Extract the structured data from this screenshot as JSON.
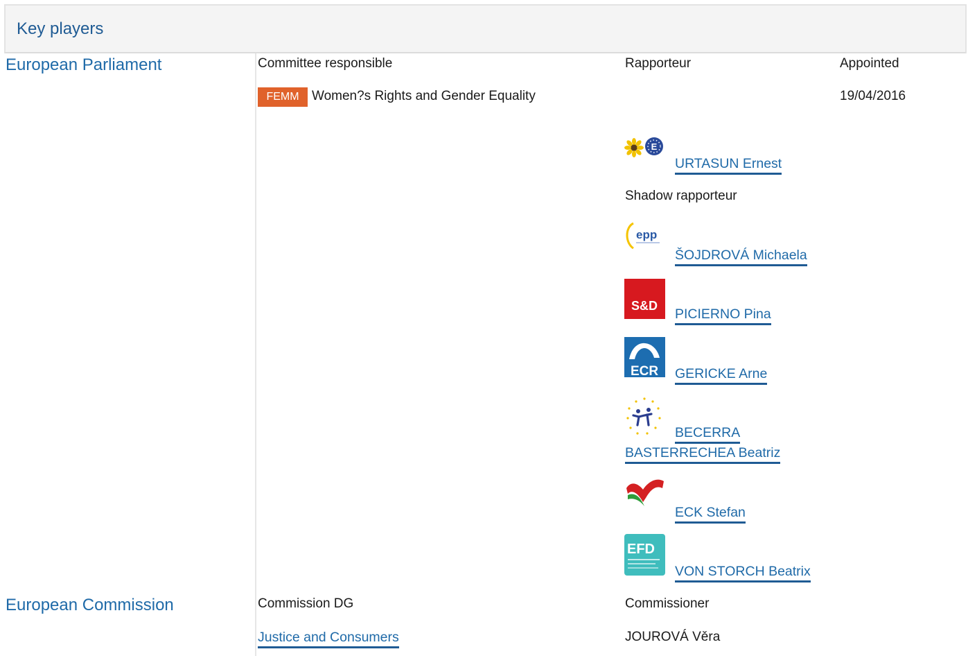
{
  "header": {
    "title": "Key players"
  },
  "parliament": {
    "label": "European Parliament",
    "committee_header": "Committee responsible",
    "rapporteur_header": "Rapporteur",
    "appointed_header": "Appointed",
    "committee_badge": "FEMM",
    "committee_name": "Women?s Rights and Gender Equality",
    "appointed_date": "19/04/2016",
    "rapporteur": {
      "name": "URTASUN Ernest",
      "group_icon": "greens-efa-logo-icon"
    },
    "shadow_header": "Shadow rapporteur",
    "shadows": [
      {
        "name": "ŠOJDROVÁ Michaela",
        "group_icon": "epp-logo-icon"
      },
      {
        "name": "PICIERNO Pina",
        "group_icon": "s-and-d-logo-icon",
        "logo_text": "S&D"
      },
      {
        "name": "GERICKE Arne",
        "group_icon": "ecr-logo-icon",
        "logo_text": "ECR"
      },
      {
        "name_line1": "BECERRA",
        "name_line2": "BASTERRECHEA Beatriz",
        "group_icon": "alde-logo-icon"
      },
      {
        "name": "ECK Stefan",
        "group_icon": "gue-ngl-logo-icon"
      },
      {
        "name": "VON STORCH Beatrix",
        "group_icon": "efdd-logo-icon",
        "logo_text": "EFD"
      }
    ],
    "colors": {
      "accent": "#1f6aa8",
      "badge": "#e0622b"
    }
  },
  "commission": {
    "label": "European Commission",
    "dg_header": "Commission DG",
    "commissioner_header": "Commissioner",
    "dg_name": "Justice and Consumers",
    "commissioner_name": "JOUROVÁ Věra"
  }
}
